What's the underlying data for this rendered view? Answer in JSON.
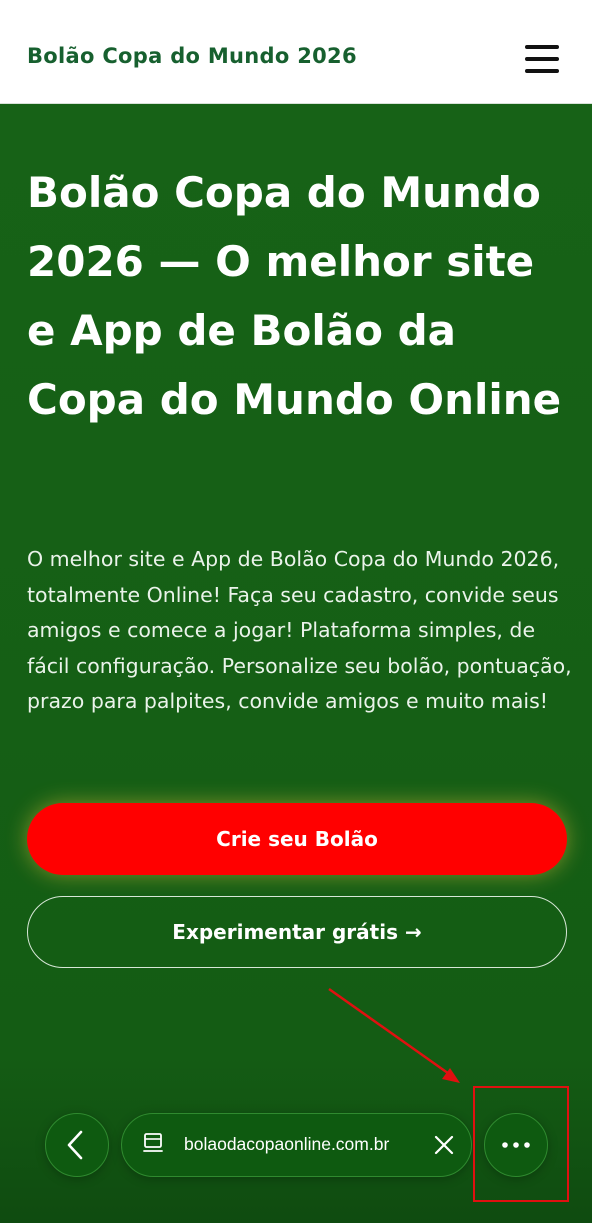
{
  "header": {
    "brand": "Bolão Copa do Mundo 2026",
    "menu_icon": "hamburger-menu-icon"
  },
  "hero": {
    "title": "Bolão Copa do Mundo 2026 — O melhor site e App de Bolão da Copa do Mundo Online",
    "description": "O melhor site e App de Bolão Copa do Mundo 2026, totalmente Online! Faça seu cadastro, convide seus amigos e comece a jogar! Plataforma simples, de fácil configuração. Personalize seu bolão, pontuação, prazo para palpites, convide amigos e muito mais!",
    "primary_button": "Crie seu Bolão",
    "secondary_button": "Experimentar grátis →"
  },
  "browser_bar": {
    "url": "bolaodacopaonline.com.br",
    "back_icon": "chevron-left-icon",
    "page_icon": "page-icon",
    "close_icon": "close-icon",
    "more_icon": "more-horizontal-icon"
  },
  "colors": {
    "brand_green": "#17602f",
    "hero_green": "#176217",
    "cta_red": "#ff0000",
    "annotation_red": "#e01010"
  }
}
